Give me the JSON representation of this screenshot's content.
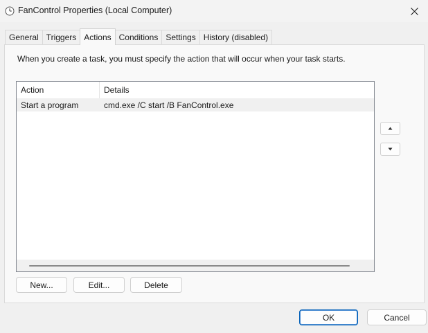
{
  "window": {
    "title": "FanControl Properties (Local Computer)"
  },
  "tabs": [
    {
      "label": "General"
    },
    {
      "label": "Triggers"
    },
    {
      "label": "Actions"
    },
    {
      "label": "Conditions"
    },
    {
      "label": "Settings"
    },
    {
      "label": "History (disabled)"
    }
  ],
  "actions_tab": {
    "description": "When you create a task, you must specify the action that will occur when your task starts.",
    "columns": {
      "action": "Action",
      "details": "Details"
    },
    "rows": [
      {
        "action": "Start a program",
        "details": "cmd.exe /C start /B FanControl.exe"
      }
    ],
    "buttons": {
      "new": "New...",
      "edit": "Edit...",
      "delete": "Delete"
    }
  },
  "footer": {
    "ok": "OK",
    "cancel": "Cancel"
  },
  "icons": {
    "title": "clock-icon",
    "close": "close-icon",
    "move_up": "move-up-arrow-icon",
    "move_down": "move-down-arrow-icon"
  },
  "colors": {
    "default_button_border": "#005fb8",
    "selected_row": "#f0f0f0"
  }
}
